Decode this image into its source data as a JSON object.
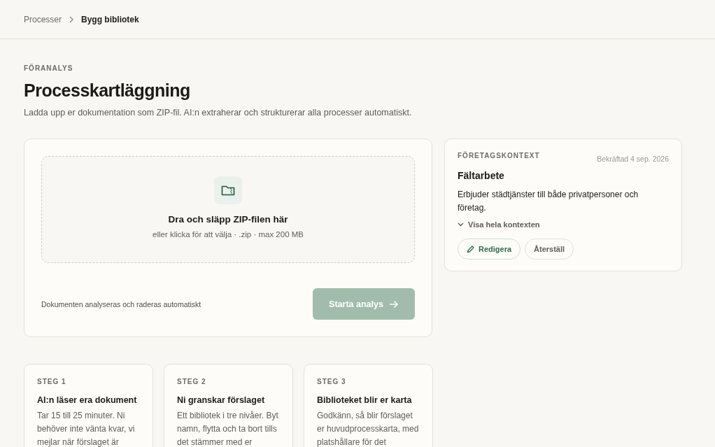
{
  "breadcrumb": [
    {
      "label": "Processer",
      "current": false
    },
    {
      "label": "Bygg bibliotek",
      "current": true
    }
  ],
  "eyebrow": "FÖRANALYS",
  "title": "Processkartläggning",
  "subtitle": "Ladda upp er dokumentation som ZIP-fil. AI:n extraherar och strukturerar alla processer automatiskt.",
  "upload": {
    "title": "Dra och släpp ZIP-filen här",
    "hint": "eller klicka för att välja · .zip · max 200 MB",
    "note": "Dokumenten analyseras och raderas automatiskt",
    "button": {
      "label": "Starta analys",
      "disabled": true
    }
  },
  "context": {
    "eyebrow": "FÖRETAGSKONTEXT",
    "confirmed": "Bekräftad 4 sep. 2026",
    "name": "Fältarbete",
    "description": "Erbjuder städtjänster till både privatpersoner och företag.",
    "toggle": {
      "label": "Visa hela kontexten",
      "expanded": false
    },
    "buttons": [
      {
        "label": "Redigera",
        "kind": "primary"
      },
      {
        "label": "Återställ",
        "kind": "plain"
      }
    ]
  },
  "steps": [
    {
      "label": "STEG 1",
      "title": "AI:n läser era dokument",
      "text": "Tar 15 till 25 minuter. Ni behöver inte vänta kvar, vi mejlar när förslaget är"
    },
    {
      "label": "STEG 2",
      "title": "Ni granskar förslaget",
      "text": "Ett bibliotek i tre nivåer. Byt namn, flytta och ta bort tills det stämmer med er"
    },
    {
      "label": "STEG 3",
      "title": "Biblioteket blir er karta",
      "text": "Godkänn, så blir förslaget er huvudprocesskarta, med platshållare för det"
    }
  ]
}
